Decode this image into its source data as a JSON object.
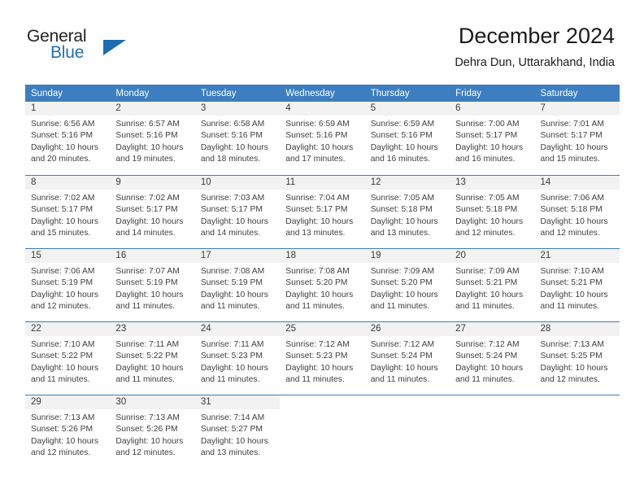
{
  "brand": {
    "word1": "General",
    "word2": "Blue",
    "triangle_icon": "brand-triangle-icon",
    "accent_color": "#1b6cb2"
  },
  "header": {
    "title": "December 2024",
    "location": "Dehra Dun, Uttarakhand, India"
  },
  "theme": {
    "header_row_bg": "#3c7ebf",
    "daynum_band_bg": "#f2f2f2",
    "grid_line": "#3c7ebf",
    "text": "#3f3f3f"
  },
  "weekday_headers": [
    "Sunday",
    "Monday",
    "Tuesday",
    "Wednesday",
    "Thursday",
    "Friday",
    "Saturday"
  ],
  "weeks": [
    [
      {
        "day": "1",
        "sunrise": "Sunrise: 6:56 AM",
        "sunset": "Sunset: 5:16 PM",
        "daylight1": "Daylight: 10 hours",
        "daylight2": "and 20 minutes."
      },
      {
        "day": "2",
        "sunrise": "Sunrise: 6:57 AM",
        "sunset": "Sunset: 5:16 PM",
        "daylight1": "Daylight: 10 hours",
        "daylight2": "and 19 minutes."
      },
      {
        "day": "3",
        "sunrise": "Sunrise: 6:58 AM",
        "sunset": "Sunset: 5:16 PM",
        "daylight1": "Daylight: 10 hours",
        "daylight2": "and 18 minutes."
      },
      {
        "day": "4",
        "sunrise": "Sunrise: 6:59 AM",
        "sunset": "Sunset: 5:16 PM",
        "daylight1": "Daylight: 10 hours",
        "daylight2": "and 17 minutes."
      },
      {
        "day": "5",
        "sunrise": "Sunrise: 6:59 AM",
        "sunset": "Sunset: 5:16 PM",
        "daylight1": "Daylight: 10 hours",
        "daylight2": "and 16 minutes."
      },
      {
        "day": "6",
        "sunrise": "Sunrise: 7:00 AM",
        "sunset": "Sunset: 5:17 PM",
        "daylight1": "Daylight: 10 hours",
        "daylight2": "and 16 minutes."
      },
      {
        "day": "7",
        "sunrise": "Sunrise: 7:01 AM",
        "sunset": "Sunset: 5:17 PM",
        "daylight1": "Daylight: 10 hours",
        "daylight2": "and 15 minutes."
      }
    ],
    [
      {
        "day": "8",
        "sunrise": "Sunrise: 7:02 AM",
        "sunset": "Sunset: 5:17 PM",
        "daylight1": "Daylight: 10 hours",
        "daylight2": "and 15 minutes."
      },
      {
        "day": "9",
        "sunrise": "Sunrise: 7:02 AM",
        "sunset": "Sunset: 5:17 PM",
        "daylight1": "Daylight: 10 hours",
        "daylight2": "and 14 minutes."
      },
      {
        "day": "10",
        "sunrise": "Sunrise: 7:03 AM",
        "sunset": "Sunset: 5:17 PM",
        "daylight1": "Daylight: 10 hours",
        "daylight2": "and 14 minutes."
      },
      {
        "day": "11",
        "sunrise": "Sunrise: 7:04 AM",
        "sunset": "Sunset: 5:17 PM",
        "daylight1": "Daylight: 10 hours",
        "daylight2": "and 13 minutes."
      },
      {
        "day": "12",
        "sunrise": "Sunrise: 7:05 AM",
        "sunset": "Sunset: 5:18 PM",
        "daylight1": "Daylight: 10 hours",
        "daylight2": "and 13 minutes."
      },
      {
        "day": "13",
        "sunrise": "Sunrise: 7:05 AM",
        "sunset": "Sunset: 5:18 PM",
        "daylight1": "Daylight: 10 hours",
        "daylight2": "and 12 minutes."
      },
      {
        "day": "14",
        "sunrise": "Sunrise: 7:06 AM",
        "sunset": "Sunset: 5:18 PM",
        "daylight1": "Daylight: 10 hours",
        "daylight2": "and 12 minutes."
      }
    ],
    [
      {
        "day": "15",
        "sunrise": "Sunrise: 7:06 AM",
        "sunset": "Sunset: 5:19 PM",
        "daylight1": "Daylight: 10 hours",
        "daylight2": "and 12 minutes."
      },
      {
        "day": "16",
        "sunrise": "Sunrise: 7:07 AM",
        "sunset": "Sunset: 5:19 PM",
        "daylight1": "Daylight: 10 hours",
        "daylight2": "and 11 minutes."
      },
      {
        "day": "17",
        "sunrise": "Sunrise: 7:08 AM",
        "sunset": "Sunset: 5:19 PM",
        "daylight1": "Daylight: 10 hours",
        "daylight2": "and 11 minutes."
      },
      {
        "day": "18",
        "sunrise": "Sunrise: 7:08 AM",
        "sunset": "Sunset: 5:20 PM",
        "daylight1": "Daylight: 10 hours",
        "daylight2": "and 11 minutes."
      },
      {
        "day": "19",
        "sunrise": "Sunrise: 7:09 AM",
        "sunset": "Sunset: 5:20 PM",
        "daylight1": "Daylight: 10 hours",
        "daylight2": "and 11 minutes."
      },
      {
        "day": "20",
        "sunrise": "Sunrise: 7:09 AM",
        "sunset": "Sunset: 5:21 PM",
        "daylight1": "Daylight: 10 hours",
        "daylight2": "and 11 minutes."
      },
      {
        "day": "21",
        "sunrise": "Sunrise: 7:10 AM",
        "sunset": "Sunset: 5:21 PM",
        "daylight1": "Daylight: 10 hours",
        "daylight2": "and 11 minutes."
      }
    ],
    [
      {
        "day": "22",
        "sunrise": "Sunrise: 7:10 AM",
        "sunset": "Sunset: 5:22 PM",
        "daylight1": "Daylight: 10 hours",
        "daylight2": "and 11 minutes."
      },
      {
        "day": "23",
        "sunrise": "Sunrise: 7:11 AM",
        "sunset": "Sunset: 5:22 PM",
        "daylight1": "Daylight: 10 hours",
        "daylight2": "and 11 minutes."
      },
      {
        "day": "24",
        "sunrise": "Sunrise: 7:11 AM",
        "sunset": "Sunset: 5:23 PM",
        "daylight1": "Daylight: 10 hours",
        "daylight2": "and 11 minutes."
      },
      {
        "day": "25",
        "sunrise": "Sunrise: 7:12 AM",
        "sunset": "Sunset: 5:23 PM",
        "daylight1": "Daylight: 10 hours",
        "daylight2": "and 11 minutes."
      },
      {
        "day": "26",
        "sunrise": "Sunrise: 7:12 AM",
        "sunset": "Sunset: 5:24 PM",
        "daylight1": "Daylight: 10 hours",
        "daylight2": "and 11 minutes."
      },
      {
        "day": "27",
        "sunrise": "Sunrise: 7:12 AM",
        "sunset": "Sunset: 5:24 PM",
        "daylight1": "Daylight: 10 hours",
        "daylight2": "and 11 minutes."
      },
      {
        "day": "28",
        "sunrise": "Sunrise: 7:13 AM",
        "sunset": "Sunset: 5:25 PM",
        "daylight1": "Daylight: 10 hours",
        "daylight2": "and 12 minutes."
      }
    ],
    [
      {
        "day": "29",
        "sunrise": "Sunrise: 7:13 AM",
        "sunset": "Sunset: 5:26 PM",
        "daylight1": "Daylight: 10 hours",
        "daylight2": "and 12 minutes."
      },
      {
        "day": "30",
        "sunrise": "Sunrise: 7:13 AM",
        "sunset": "Sunset: 5:26 PM",
        "daylight1": "Daylight: 10 hours",
        "daylight2": "and 12 minutes."
      },
      {
        "day": "31",
        "sunrise": "Sunrise: 7:14 AM",
        "sunset": "Sunset: 5:27 PM",
        "daylight1": "Daylight: 10 hours",
        "daylight2": "and 13 minutes."
      },
      {
        "day": "",
        "sunrise": "",
        "sunset": "",
        "daylight1": "",
        "daylight2": ""
      },
      {
        "day": "",
        "sunrise": "",
        "sunset": "",
        "daylight1": "",
        "daylight2": ""
      },
      {
        "day": "",
        "sunrise": "",
        "sunset": "",
        "daylight1": "",
        "daylight2": ""
      },
      {
        "day": "",
        "sunrise": "",
        "sunset": "",
        "daylight1": "",
        "daylight2": ""
      }
    ]
  ]
}
